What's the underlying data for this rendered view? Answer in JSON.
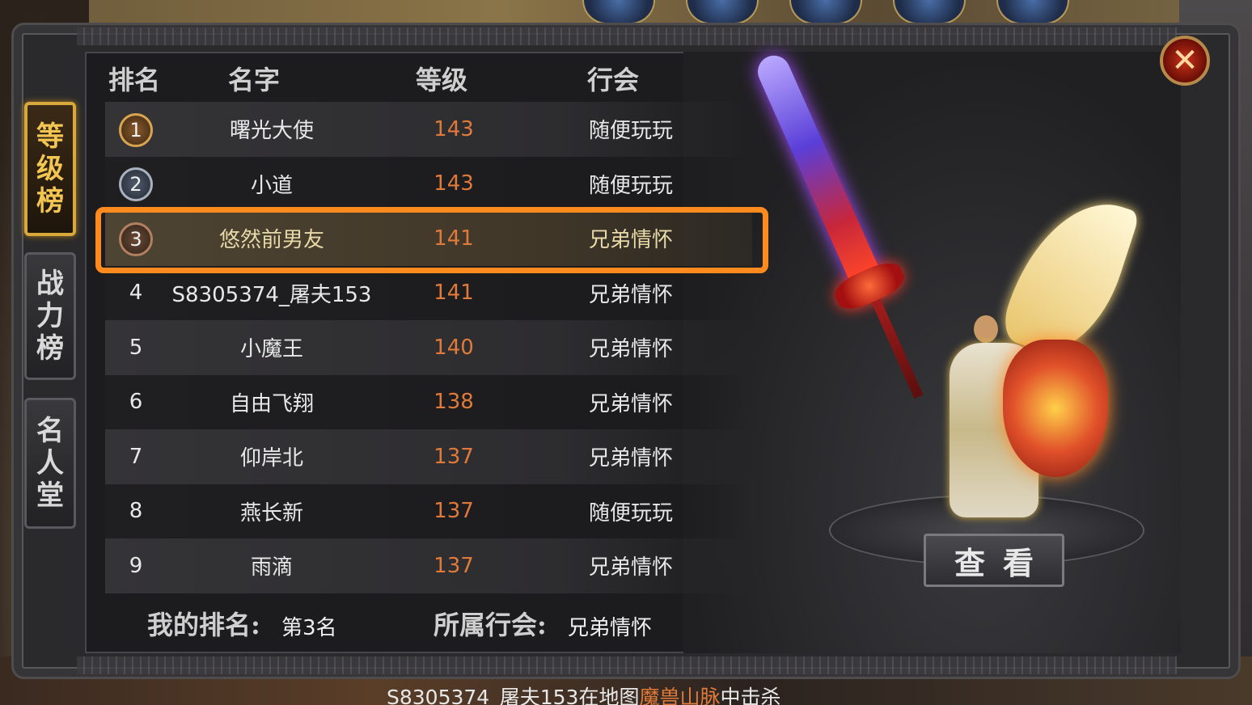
{
  "tabs": [
    {
      "label": "等级榜",
      "chars": [
        "等",
        "级",
        "榜"
      ],
      "active": true
    },
    {
      "label": "战力榜",
      "chars": [
        "战",
        "力",
        "榜"
      ],
      "active": false
    },
    {
      "label": "名人堂",
      "chars": [
        "名",
        "人",
        "堂"
      ],
      "active": false
    }
  ],
  "table": {
    "headers": {
      "rank": "排名",
      "name": "名字",
      "level": "等级",
      "guild": "行会"
    },
    "rows": [
      {
        "rank": "1",
        "name": "曙光大使",
        "level": "143",
        "guild": "随便玩玩",
        "medal": "gold"
      },
      {
        "rank": "2",
        "name": "小道",
        "level": "143",
        "guild": "随便玩玩",
        "medal": "silver"
      },
      {
        "rank": "3",
        "name": "悠然前男友",
        "level": "141",
        "guild": "兄弟情怀",
        "medal": "bronze"
      },
      {
        "rank": "4",
        "name": "S8305374_屠夫153",
        "level": "141",
        "guild": "兄弟情怀"
      },
      {
        "rank": "5",
        "name": "小魔王",
        "level": "140",
        "guild": "兄弟情怀"
      },
      {
        "rank": "6",
        "name": "自由飞翔",
        "level": "138",
        "guild": "兄弟情怀"
      },
      {
        "rank": "7",
        "name": "仰岸北",
        "level": "137",
        "guild": "兄弟情怀"
      },
      {
        "rank": "8",
        "name": "燕长新",
        "level": "137",
        "guild": "随便玩玩"
      },
      {
        "rank": "9",
        "name": "雨滴",
        "level": "137",
        "guild": "兄弟情怀"
      }
    ],
    "selected_rank": "3"
  },
  "footer": {
    "my_rank_label": "我的排名:",
    "my_rank_value": "第3名",
    "guild_label": "所属行会:",
    "guild_value": "兄弟情怀"
  },
  "view_button": "查看",
  "close_symbol": "✕",
  "ticker": {
    "player": "S8305374_屠夫153",
    "text1": "在地图",
    "place": "魔兽山脉",
    "text2": "中击杀"
  },
  "colors": {
    "level_orange": "#e07a3a",
    "highlight": "#ff8a1e",
    "active_tab_gold": "#f3c652"
  }
}
